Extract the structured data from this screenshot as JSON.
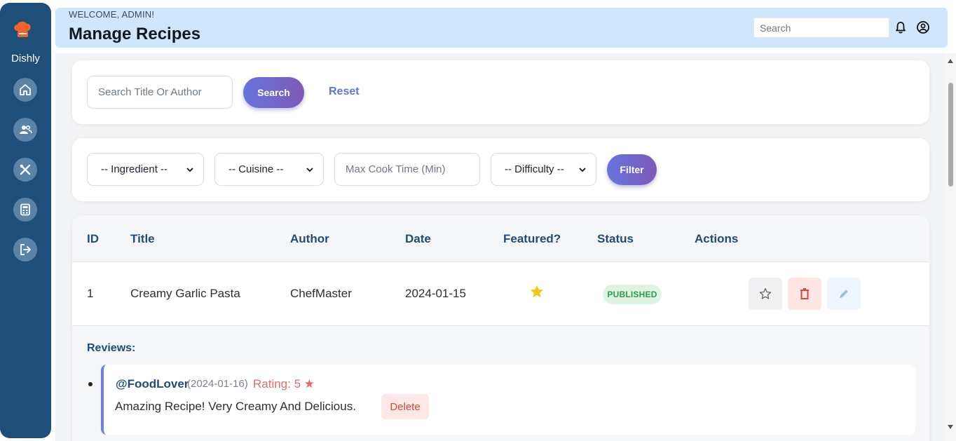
{
  "sidebar": {
    "brand": "Dishly",
    "items": [
      {
        "name": "home-icon"
      },
      {
        "name": "users-icon"
      },
      {
        "name": "utensils-icon"
      },
      {
        "name": "calculator-icon"
      },
      {
        "name": "logout-icon"
      }
    ]
  },
  "header": {
    "welcome": "WELCOME, ADMIN!",
    "title": "Manage Recipes",
    "search_placeholder": "Search"
  },
  "search_card": {
    "input_placeholder": "Search Title Or Author",
    "search_label": "Search",
    "reset_label": "Reset"
  },
  "filter_card": {
    "ingredient": "-- Ingredient --",
    "cuisine": "-- Cuisine --",
    "max_cook_placeholder": "Max Cook Time (Min)",
    "difficulty": "-- Difficulty --",
    "filter_label": "Filter"
  },
  "table": {
    "headers": {
      "id": "ID",
      "title": "Title",
      "author": "Author",
      "date": "Date",
      "featured": "Featured?",
      "status": "Status",
      "actions": "Actions"
    },
    "rows": [
      {
        "id": "1",
        "title": "Creamy Garlic Pasta",
        "author": "ChefMaster",
        "date": "2024-01-15",
        "featured": true,
        "status": "PUBLISHED"
      }
    ]
  },
  "reviews": {
    "title": "Reviews:",
    "items": [
      {
        "user": "@FoodLover",
        "date": "(2024-01-16)",
        "rating": "Rating: 5 ★",
        "text": "Amazing Recipe! Very Creamy And Delicious.",
        "delete_label": "Delete"
      }
    ]
  },
  "colors": {
    "sidebar": "#1d4f7a",
    "header": "#cfe6fd",
    "accent": "#6675dd",
    "published": "#2e9b48",
    "danger": "#d9463c",
    "star": "#f5c518"
  }
}
